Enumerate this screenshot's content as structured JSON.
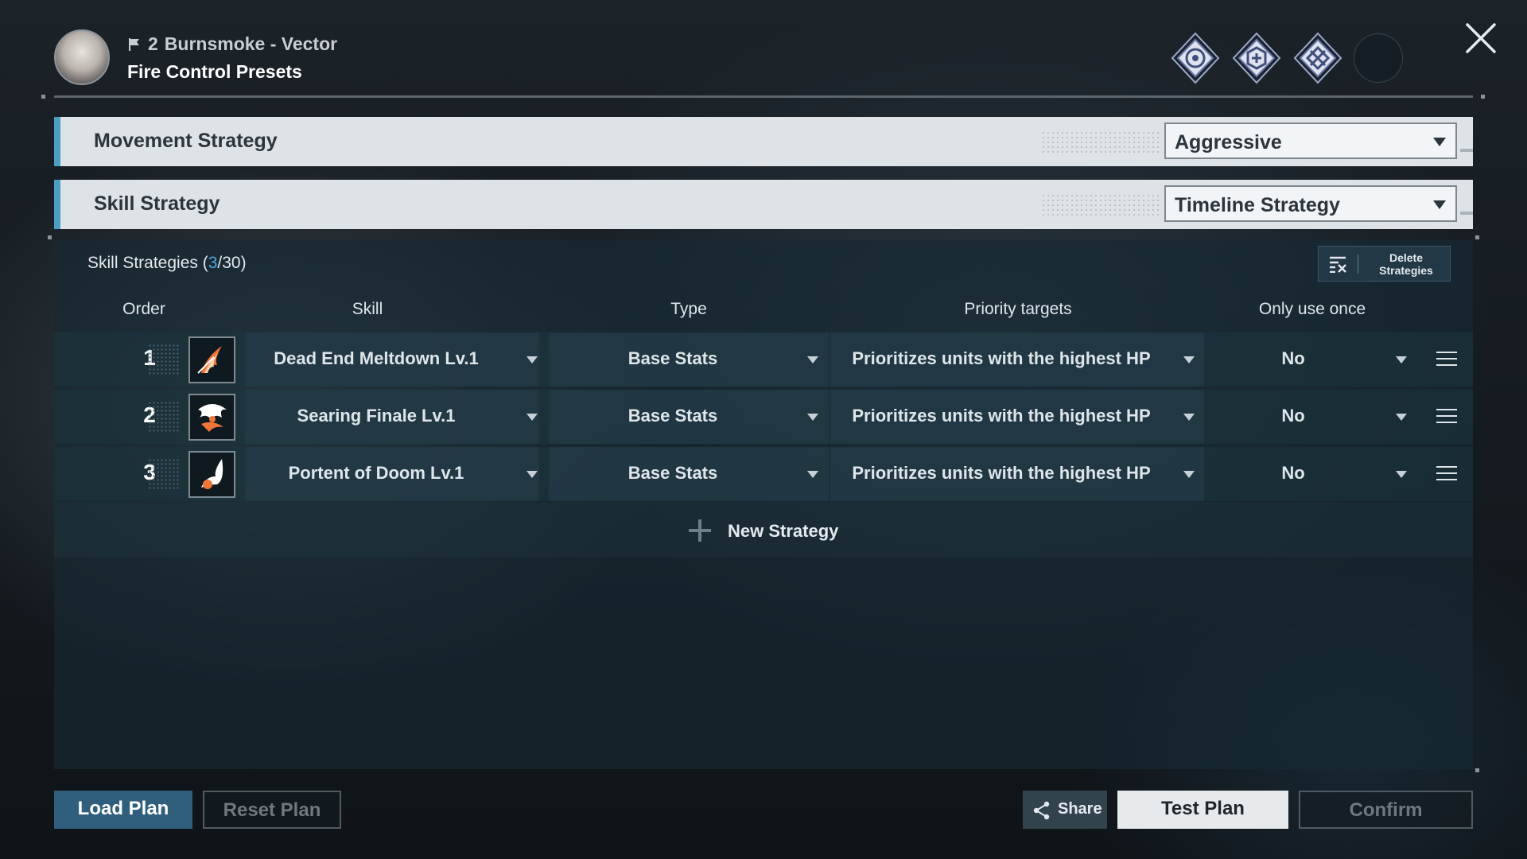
{
  "header": {
    "squad_number": "2",
    "unit_name": "Burnsmoke - Vector",
    "title": "Fire Control Presets",
    "badges": [
      "badge-1-icon",
      "badge-2-icon",
      "badge-3-icon"
    ]
  },
  "movement": {
    "label": "Movement Strategy",
    "value": "Aggressive"
  },
  "skill_strategy": {
    "label": "Skill Strategy",
    "value": "Timeline Strategy"
  },
  "panel": {
    "title_prefix": "Skill Strategies (",
    "count_current": "3",
    "count_suffix": "/30)",
    "delete_label": "Delete Strategies",
    "columns": {
      "order": "Order",
      "skill": "Skill",
      "type": "Type",
      "priority": "Priority targets",
      "once": "Only use once"
    },
    "rows": [
      {
        "order": "1",
        "skill": "Dead End Meltdown Lv.1",
        "type": "Base Stats",
        "priority": "Prioritizes units with the highest HP",
        "once": "No"
      },
      {
        "order": "2",
        "skill": "Searing Finale Lv.1",
        "type": "Base Stats",
        "priority": "Prioritizes units with the highest HP",
        "once": "No"
      },
      {
        "order": "3",
        "skill": "Portent of Doom Lv.1",
        "type": "Base Stats",
        "priority": "Prioritizes units with the highest HP",
        "once": "No"
      }
    ],
    "new_strategy": "New Strategy"
  },
  "footer": {
    "load": "Load Plan",
    "reset": "Reset Plan",
    "share": "Share",
    "test": "Test Plan",
    "confirm": "Confirm"
  },
  "colors": {
    "accent": "#4aa8e0",
    "bar_edge": "#4a9fc2",
    "primary_button": "#2f5f7c"
  }
}
